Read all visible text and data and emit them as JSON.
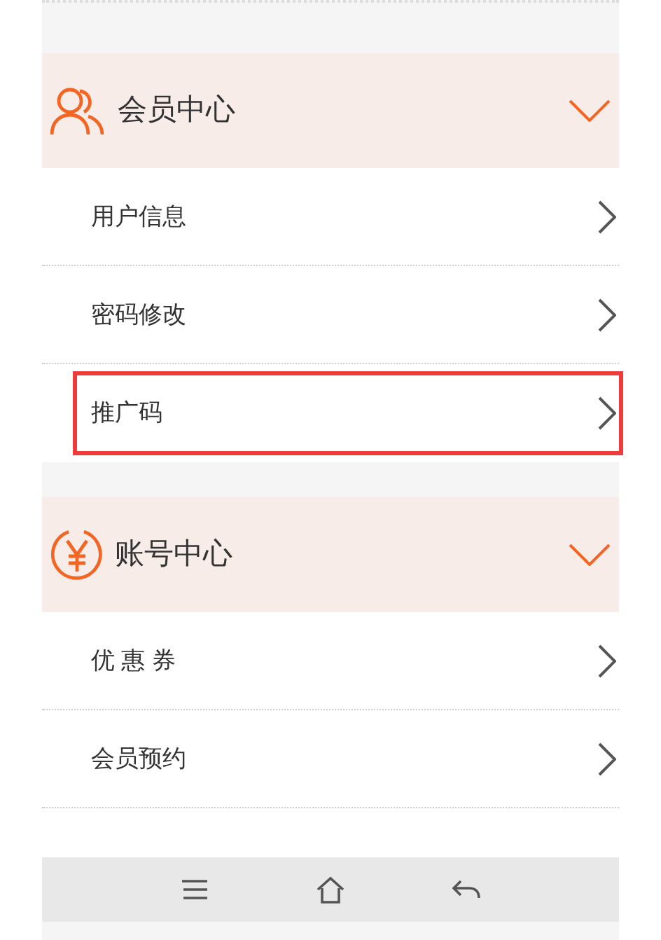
{
  "sections": [
    {
      "title": "会员中心",
      "kind": "people",
      "expanded": true,
      "items": [
        {
          "label": "用户信息",
          "highlighted": false
        },
        {
          "label": "密码修改",
          "highlighted": false
        },
        {
          "label": "推广码",
          "highlighted": true
        }
      ]
    },
    {
      "title": "账号中心",
      "kind": "yen",
      "expanded": true,
      "items": [
        {
          "label": "优 惠 券",
          "highlighted": false
        },
        {
          "label": "会员预约",
          "highlighted": false
        }
      ]
    }
  ],
  "nav_bar": [
    {
      "kind": "menu"
    },
    {
      "kind": "home"
    },
    {
      "kind": "back"
    }
  ]
}
